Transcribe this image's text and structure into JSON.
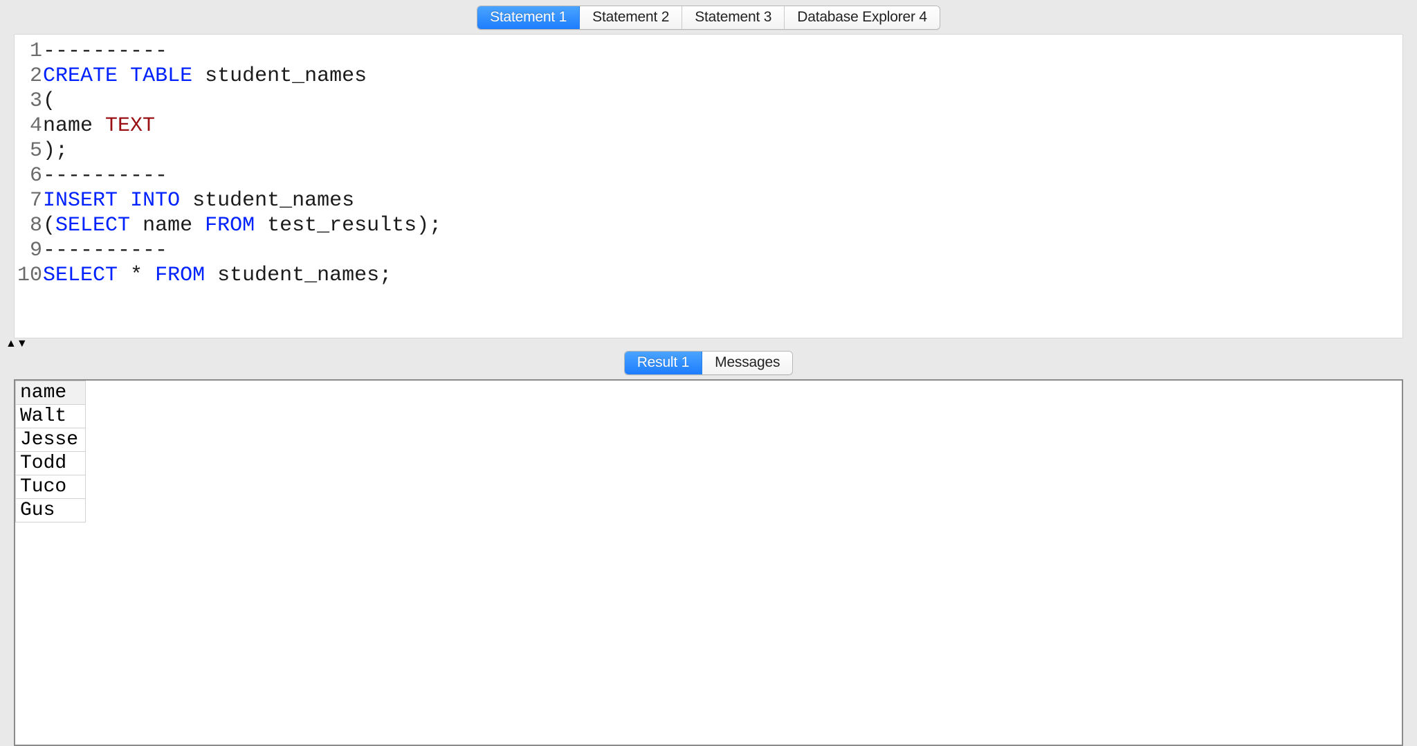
{
  "top_tabs": {
    "items": [
      {
        "label": "Statement 1",
        "active": true
      },
      {
        "label": "Statement 2",
        "active": false
      },
      {
        "label": "Statement 3",
        "active": false
      },
      {
        "label": "Database Explorer 4",
        "active": false
      }
    ]
  },
  "editor": {
    "lines": [
      {
        "n": "1",
        "tokens": [
          {
            "t": "----------",
            "c": "sym"
          }
        ]
      },
      {
        "n": "2",
        "tokens": [
          {
            "t": "CREATE",
            "c": "kw"
          },
          {
            "t": " "
          },
          {
            "t": "TABLE",
            "c": "kw"
          },
          {
            "t": " student_names"
          }
        ]
      },
      {
        "n": "3",
        "tokens": [
          {
            "t": "("
          }
        ]
      },
      {
        "n": "4",
        "tokens": [
          {
            "t": "name "
          },
          {
            "t": "TEXT",
            "c": "typ"
          }
        ]
      },
      {
        "n": "5",
        "tokens": [
          {
            "t": ");"
          }
        ]
      },
      {
        "n": "6",
        "tokens": [
          {
            "t": "----------",
            "c": "sym"
          }
        ]
      },
      {
        "n": "7",
        "tokens": [
          {
            "t": "INSERT",
            "c": "kw"
          },
          {
            "t": " "
          },
          {
            "t": "INTO",
            "c": "kw"
          },
          {
            "t": " student_names"
          }
        ]
      },
      {
        "n": "8",
        "tokens": [
          {
            "t": "("
          },
          {
            "t": "SELECT",
            "c": "kw"
          },
          {
            "t": " name "
          },
          {
            "t": "FROM",
            "c": "kw"
          },
          {
            "t": " test_results);"
          }
        ]
      },
      {
        "n": "9",
        "tokens": [
          {
            "t": "----------",
            "c": "sym"
          }
        ]
      },
      {
        "n": "10",
        "tokens": [
          {
            "t": "SELECT",
            "c": "kw"
          },
          {
            "t": " * "
          },
          {
            "t": "FROM",
            "c": "kw"
          },
          {
            "t": " student_names;"
          }
        ]
      }
    ]
  },
  "bottom_tabs": {
    "items": [
      {
        "label": "Result 1",
        "active": true
      },
      {
        "label": "Messages",
        "active": false
      }
    ]
  },
  "results": {
    "columns": [
      "name"
    ],
    "rows": [
      [
        "Walt"
      ],
      [
        "Jesse"
      ],
      [
        "Todd"
      ],
      [
        "Tuco"
      ],
      [
        "Gus"
      ]
    ]
  }
}
